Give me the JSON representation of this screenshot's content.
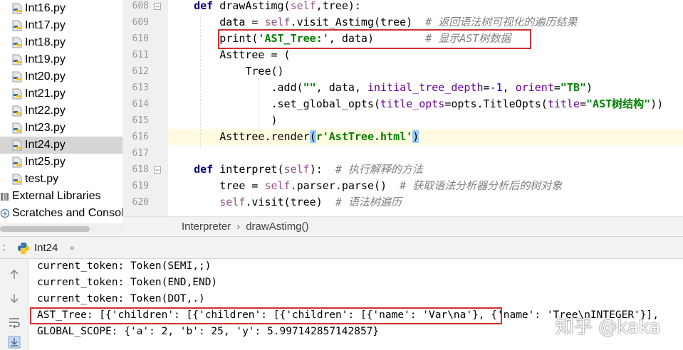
{
  "project_tree": {
    "files": [
      {
        "label": "Int16.py"
      },
      {
        "label": "Int17.py"
      },
      {
        "label": "Int18.py"
      },
      {
        "label": "Int19.py"
      },
      {
        "label": "Int20.py"
      },
      {
        "label": "Int21.py"
      },
      {
        "label": "Int22.py"
      },
      {
        "label": "Int23.py"
      },
      {
        "label": "Int24.py",
        "selected": true
      },
      {
        "label": "Int25.py"
      },
      {
        "label": "test.py"
      }
    ],
    "external_libraries": "External Libraries",
    "scratches": "Scratches and Consoles"
  },
  "editor": {
    "line_numbers": [
      "608",
      "609",
      "610",
      "611",
      "612",
      "613",
      "614",
      "615",
      "616",
      "617",
      "618",
      "619",
      "620"
    ],
    "lines": {
      "l608": {
        "indent": "    ",
        "kw": "def",
        "name": " drawAstimg(",
        "self": "self",
        "rest": ",tree):"
      },
      "l609": {
        "indent": "        ",
        "a": "data = ",
        "self": "self",
        "b": ".visit_Astimg(tree)  ",
        "comment": "# 返回语法树可视化的遍历结果"
      },
      "l610": {
        "indent": "        ",
        "a": "print(",
        "str": "'AST_Tree:'",
        "b": ", data)        ",
        "comment": "# 显示AST树数据"
      },
      "l611": {
        "indent": "        ",
        "text": "Asttree = ("
      },
      "l612": {
        "indent": "            ",
        "text": "Tree()"
      },
      "l613": {
        "indent": "                ",
        "a": ".add(",
        "s1": "\"\"",
        "b": ", data, ",
        "p1": "initial_tree_depth",
        "c": "=",
        "n1": "-1",
        "d": ", ",
        "p2": "orient",
        "e": "=",
        "s2": "\"TB\"",
        "f": ")"
      },
      "l614": {
        "indent": "                ",
        "a": ".set_global_opts(",
        "p1": "title_opts",
        "b": "=opts.TitleOpts(",
        "p2": "title",
        "c": "=",
        "s1": "\"AST树结构\"",
        "d": "))"
      },
      "l615": {
        "indent": "                ",
        "text": ")"
      },
      "l616": {
        "indent": "        ",
        "a": "Asttree.render",
        "b1": "(",
        "s1": "r'AstTree.html'",
        "b2": ")"
      },
      "l618": {
        "indent": "    ",
        "kw": "def",
        "name": " interpret(",
        "self": "self",
        "rest": "):  ",
        "comment": "# 执行解释的方法"
      },
      "l619": {
        "indent": "        ",
        "a": "tree = ",
        "self": "self",
        "b": ".parser.parse()  ",
        "comment": "# 获取语法分析器分析后的树对象"
      },
      "l620": {
        "indent": "        ",
        "self": "self",
        "b": ".visit(tree)  ",
        "comment": "# 语法树遍历"
      }
    }
  },
  "breadcrumb": {
    "items": [
      "Interpreter",
      "drawAstimg()"
    ],
    "separator": "›"
  },
  "run_panel": {
    "label": ":",
    "tab_label": "Int24",
    "close": "×",
    "console_lines": [
      "current_token: Token(SEMI,;)",
      "current_token: Token(END,END)",
      "current_token: Token(DOT,.)",
      "AST_Tree: [{'children': [{'children': [{'children': [{'name': 'Var\\na'}, {'name': 'Tree\\nINTEGER'}],",
      "GLOBAL_SCOPE: {'a': 2, 'b': 25, 'y': 5.997142857142857}"
    ]
  },
  "watermark": "知乎 @kaka",
  "colors": {
    "highlight_box": "#d32f2f",
    "keyword": "#000080",
    "string": "#008000",
    "comment": "#808080",
    "self": "#94558d"
  }
}
